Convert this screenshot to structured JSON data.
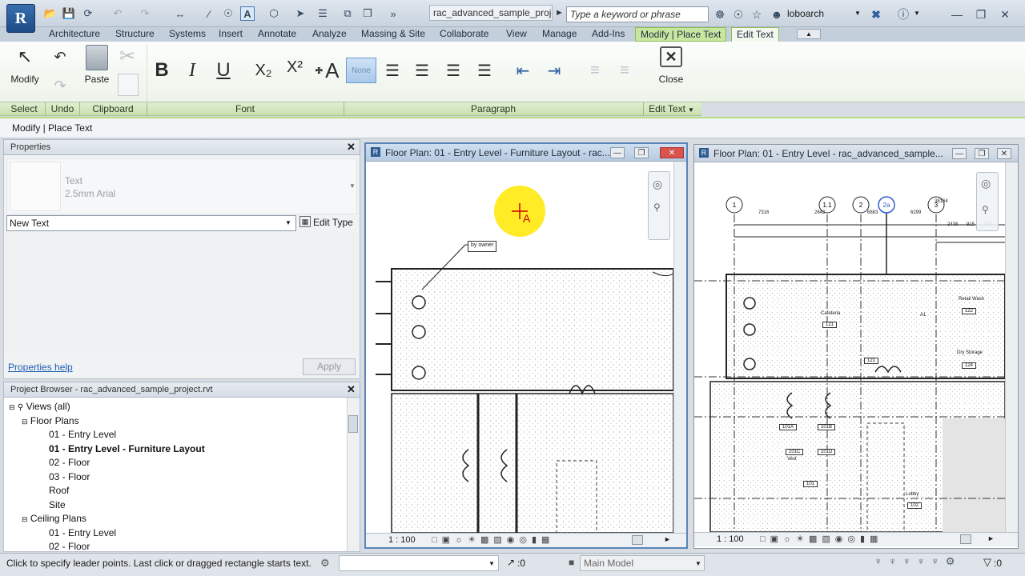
{
  "app": {
    "logo_letter": "R",
    "title": "rac_advanced_sample_proje...",
    "search_placeholder": "Type a keyword or phrase",
    "user": "loboarch"
  },
  "tabs": [
    "Architecture",
    "Structure",
    "Systems",
    "Insert",
    "Annotate",
    "Analyze",
    "Massing & Site",
    "Collaborate",
    "View",
    "Manage",
    "Add-Ins",
    "Modify | Place Text",
    "Edit Text"
  ],
  "ribbon": {
    "modify": "Modify",
    "paste": "Paste",
    "close": "Close",
    "none_style": "None",
    "panels": {
      "select": "Select",
      "undo": "Undo",
      "clipboard": "Clipboard",
      "font": "Font",
      "paragraph": "Paragraph",
      "edit_text": "Edit Text"
    },
    "font_buttons": {
      "bold": "B",
      "italic": "I",
      "underline": "U",
      "subscript": "X₂",
      "superscript": "X²"
    }
  },
  "optbar": {
    "label": "Modify | Place Text"
  },
  "properties": {
    "title": "Properties",
    "type_name": "Text",
    "type_sub": "2.5mm Arial",
    "selector": "New Text",
    "edit_type": "Edit Type",
    "help": "Properties help",
    "apply": "Apply"
  },
  "browser": {
    "title": "Project Browser - rac_advanced_sample_project.rvt",
    "items": [
      "Views (all)",
      "Floor Plans",
      "01 - Entry Level",
      "01 - Entry Level - Furniture Layout",
      "02 - Floor",
      "03 - Floor",
      "Roof",
      "Site",
      "Ceiling Plans",
      "01 - Entry Level",
      "02 - Floor"
    ]
  },
  "view1": {
    "title": "Floor Plan: 01 - Entry Level - Furniture Layout - rac...",
    "scale": "1 : 100",
    "tag": "by owner"
  },
  "view2": {
    "title": "Floor Plan: 01 - Entry Level - rac_advanced_sample...",
    "scale": "1 : 100",
    "grids": [
      "1",
      "1.1",
      "2",
      "2a",
      "3"
    ],
    "dims": [
      "7316",
      "2642",
      "6883",
      "6299",
      "2438",
      "915",
      "915",
      "38164"
    ],
    "rooms": [
      "Cafeteria",
      "121",
      "Retail Wash",
      "122",
      "Dry Storage",
      "124",
      "Lobby",
      "102",
      "101",
      "101A",
      "101B",
      "101C",
      "101D",
      "Vest",
      "A1",
      "121"
    ]
  },
  "status": {
    "message": "Click to specify leader points.  Last click or dragged rectangle starts text.",
    "count": ":0",
    "model": "Main Model",
    "filter": ":0"
  },
  "colors": {
    "context_tab": "#c8e6a0",
    "accent": "#8dbb55",
    "view_active": "#cfe0f1"
  }
}
